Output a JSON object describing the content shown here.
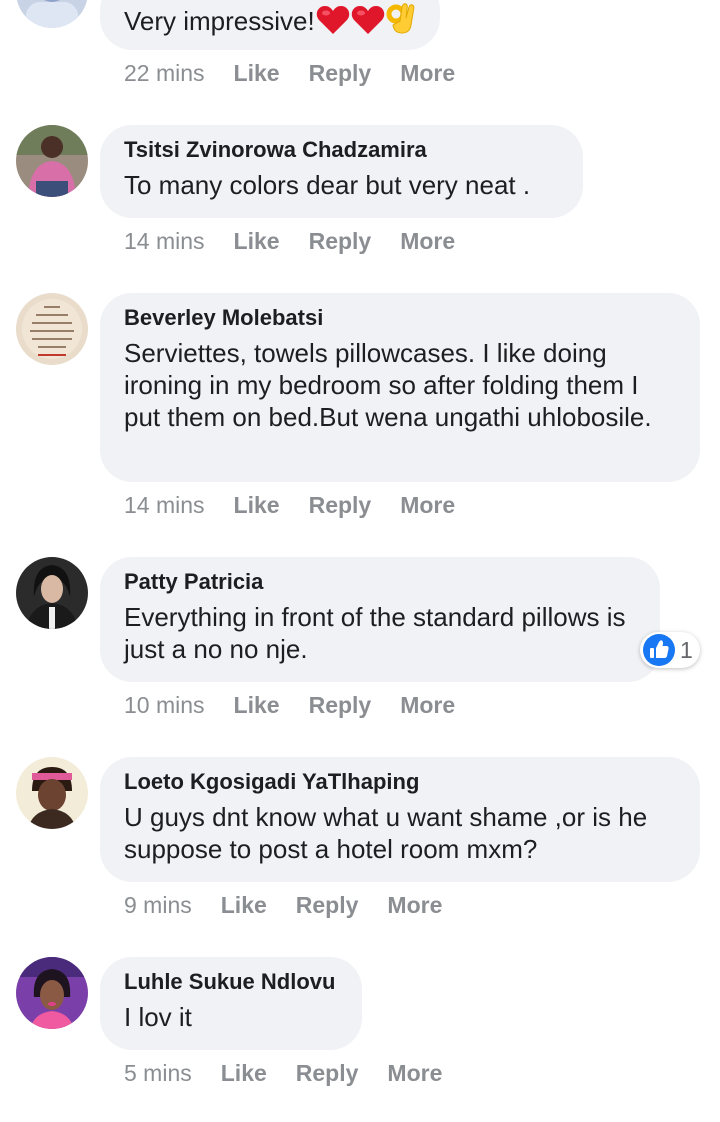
{
  "comments": [
    {
      "author": "",
      "text": "Very impressive!",
      "emojis": [
        "red-heart-emoji",
        "red-heart-emoji",
        "ok-hand-emoji"
      ],
      "time": "22 mins",
      "like_label": "Like",
      "reply_label": "Reply",
      "more_label": "More"
    },
    {
      "author": "Tsitsi Zvinorowa Chadzamira",
      "text": "To many colors dear but very neat .",
      "time": "14 mins",
      "like_label": "Like",
      "reply_label": "Reply",
      "more_label": "More"
    },
    {
      "author": "Beverley Molebatsi",
      "text": "Serviettes, towels pillowcases. I like doing ironing in my bedroom so after folding them I put them on bed.But wena ungathi uhlobosile.",
      "time": "14 mins",
      "like_label": "Like",
      "reply_label": "Reply",
      "more_label": "More"
    },
    {
      "author": "Patty Patricia",
      "text": "Everything in front of the standard pillows is just a no no nje.",
      "time": "10 mins",
      "like_label": "Like",
      "reply_label": "Reply",
      "more_label": "More",
      "reaction": {
        "icon": "thumbs-up-icon",
        "count": "1"
      }
    },
    {
      "author": "Loeto Kgosigadi YaTlhaping",
      "text": "U guys dnt know what u want shame ,or is he suppose to post a hotel room mxm?",
      "time": "9 mins",
      "like_label": "Like",
      "reply_label": "Reply",
      "more_label": "More"
    },
    {
      "author": "Luhle Sukue Ndlovu",
      "text": "I lov it",
      "time": "5 mins",
      "like_label": "Like",
      "reply_label": "Reply",
      "more_label": "More"
    }
  ],
  "colors": {
    "bubble": "#f0f2f5",
    "text": "#1c1e21",
    "meta": "#8a8d91",
    "like_blue": "#1877f2",
    "heart_red": "#e0162b",
    "emoji_yellow": "#ffcc33"
  }
}
